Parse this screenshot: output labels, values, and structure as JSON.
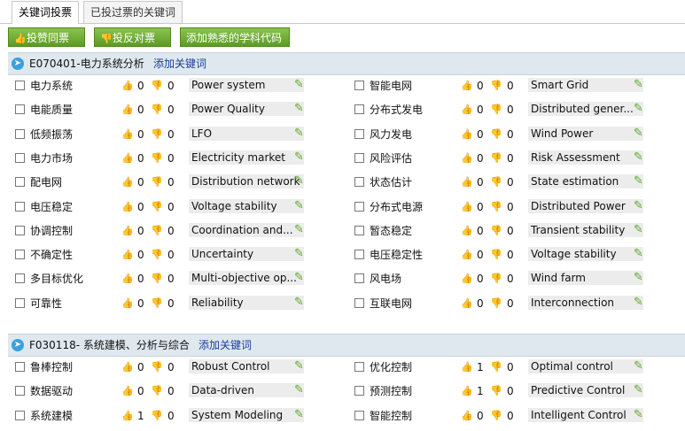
{
  "tabs": [
    "关键词投票",
    "已投过票的关键词"
  ],
  "toolbar": {
    "vote_for": "投赞同票",
    "vote_against": "投反对票",
    "add_code": "添加熟悉的学科代码"
  },
  "sections": [
    {
      "code": "E070401-电力系统分析",
      "add_label": "添加关键词",
      "left": [
        {
          "cn": "电力系统",
          "up": "0",
          "down": "0",
          "en": "Power system"
        },
        {
          "cn": "电能质量",
          "up": "0",
          "down": "0",
          "en": "Power Quality"
        },
        {
          "cn": "低频振荡",
          "up": "0",
          "down": "0",
          "en": "LFO"
        },
        {
          "cn": "电力市场",
          "up": "0",
          "down": "0",
          "en": "Electricity market"
        },
        {
          "cn": "配电网",
          "up": "0",
          "down": "0",
          "en": "Distribution network"
        },
        {
          "cn": "电压稳定",
          "up": "0",
          "down": "0",
          "en": "Voltage stability"
        },
        {
          "cn": "协调控制",
          "up": "0",
          "down": "0",
          "en": "Coordination and..."
        },
        {
          "cn": "不确定性",
          "up": "0",
          "down": "0",
          "en": "Uncertainty"
        },
        {
          "cn": "多目标优化",
          "up": "0",
          "down": "0",
          "en": "Multi-objective op..."
        },
        {
          "cn": "可靠性",
          "up": "0",
          "down": "0",
          "en": "Reliability"
        }
      ],
      "right": [
        {
          "cn": "智能电网",
          "up": "0",
          "down": "0",
          "en": "Smart Grid"
        },
        {
          "cn": "分布式发电",
          "up": "0",
          "down": "0",
          "en": "Distributed gener..."
        },
        {
          "cn": "风力发电",
          "up": "0",
          "down": "0",
          "en": "Wind Power"
        },
        {
          "cn": "风险评估",
          "up": "0",
          "down": "0",
          "en": "Risk Assessment"
        },
        {
          "cn": "状态估计",
          "up": "0",
          "down": "0",
          "en": "State estimation"
        },
        {
          "cn": "分布式电源",
          "up": "0",
          "down": "0",
          "en": "Distributed Power"
        },
        {
          "cn": "暂态稳定",
          "up": "0",
          "down": "0",
          "en": "Transient stability"
        },
        {
          "cn": "电压稳定性",
          "up": "0",
          "down": "0",
          "en": "Voltage stability"
        },
        {
          "cn": "风电场",
          "up": "0",
          "down": "0",
          "en": "Wind farm"
        },
        {
          "cn": "互联电网",
          "up": "0",
          "down": "0",
          "en": "Interconnection"
        }
      ]
    },
    {
      "code": "F030118- 系统建模、分析与综合",
      "add_label": "添加关键词",
      "left": [
        {
          "cn": "鲁棒控制",
          "up": "0",
          "down": "0",
          "en": "Robust Control"
        },
        {
          "cn": "数据驱动",
          "up": "0",
          "down": "0",
          "en": "Data-driven"
        },
        {
          "cn": "系统建模",
          "up": "1",
          "down": "0",
          "en": "System Modeling"
        }
      ],
      "right": [
        {
          "cn": "优化控制",
          "up": "1",
          "down": "0",
          "en": "Optimal control"
        },
        {
          "cn": "预测控制",
          "up": "1",
          "down": "0",
          "en": "Predictive Control"
        },
        {
          "cn": "智能控制",
          "up": "0",
          "down": "0",
          "en": "Intelligent Control"
        }
      ]
    }
  ]
}
